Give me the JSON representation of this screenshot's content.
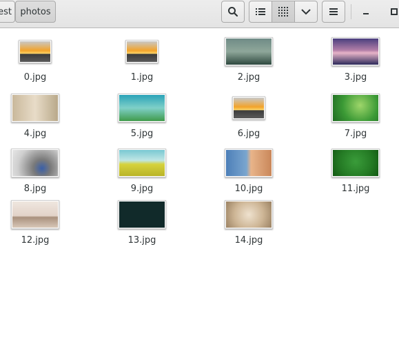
{
  "breadcrumb": {
    "previous": "test",
    "current": "photos"
  },
  "toolbar": {
    "search_icon": "search-icon",
    "list_view_icon": "list-view-icon",
    "grid_view_icon": "grid-view-icon",
    "view_options_icon": "chevron-down-icon",
    "menu_icon": "hamburger-menu-icon",
    "minimize_icon": "minimize-icon",
    "maximize_icon": "maximize-icon"
  },
  "files": [
    {
      "name": "0.jpg"
    },
    {
      "name": "1.jpg"
    },
    {
      "name": "2.jpg"
    },
    {
      "name": "3.jpg"
    },
    {
      "name": "4.jpg"
    },
    {
      "name": "5.jpg"
    },
    {
      "name": "6.jpg"
    },
    {
      "name": "7.jpg"
    },
    {
      "name": "8.jpg"
    },
    {
      "name": "9.jpg"
    },
    {
      "name": "10.jpg"
    },
    {
      "name": "11.jpg"
    },
    {
      "name": "12.jpg"
    },
    {
      "name": "13.jpg"
    },
    {
      "name": "14.jpg"
    }
  ]
}
